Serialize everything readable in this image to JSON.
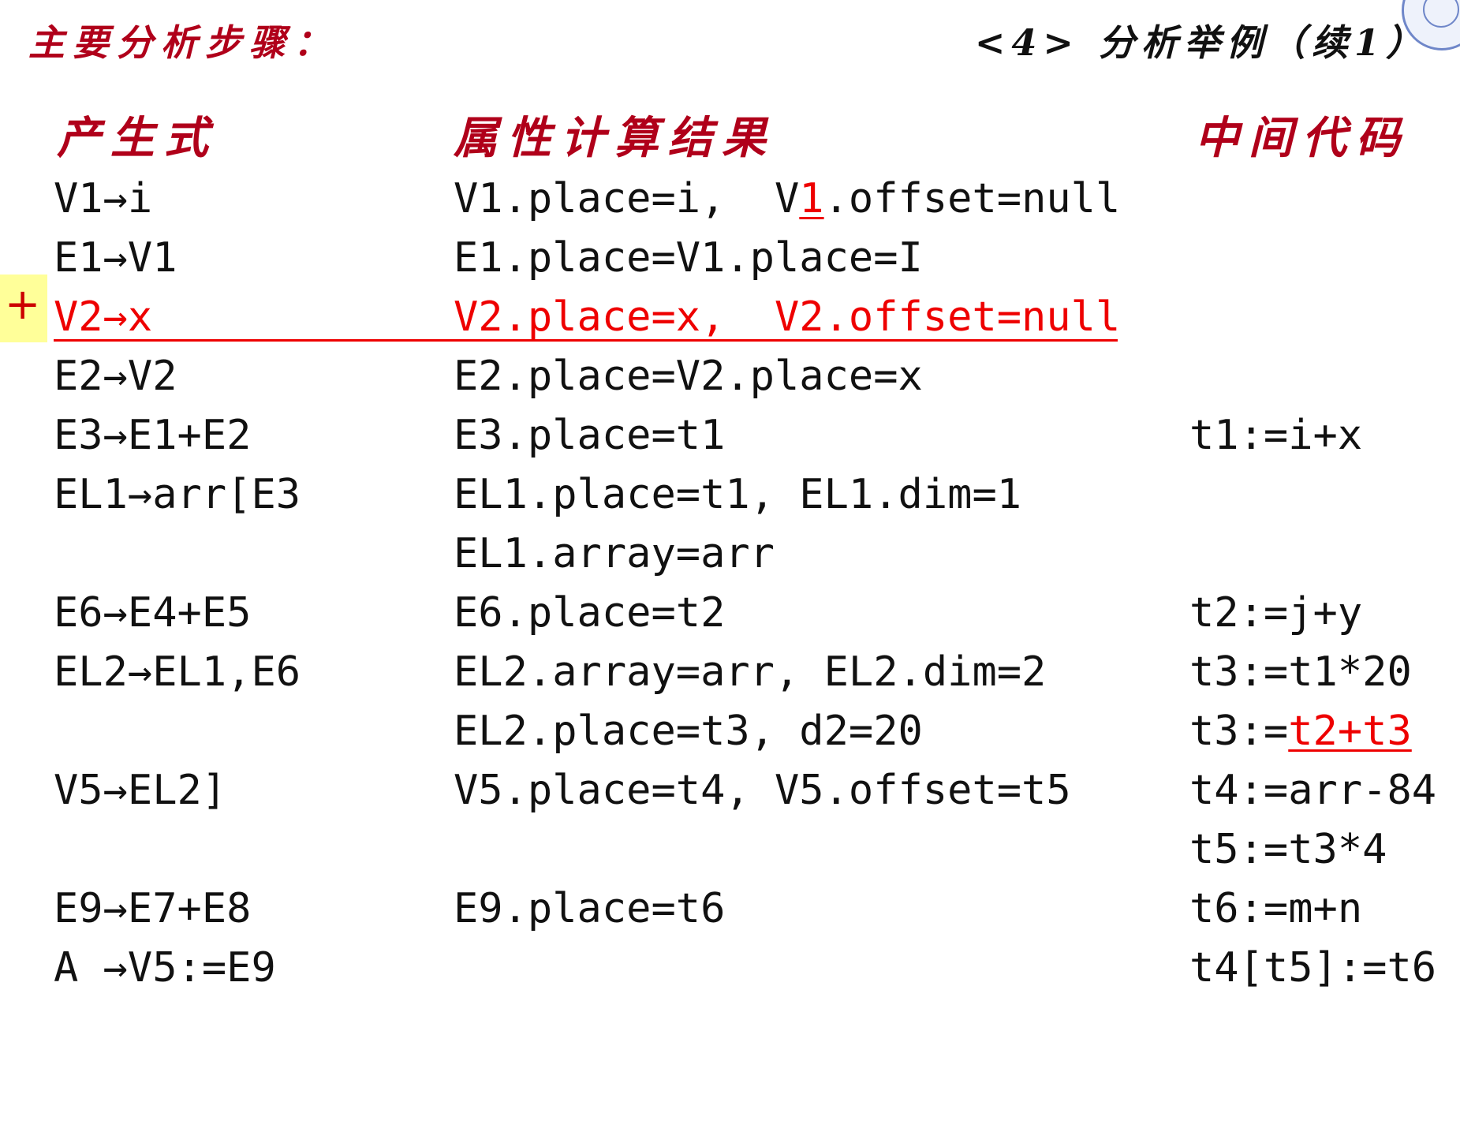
{
  "title": {
    "left": "主要分析步骤：",
    "right": "<4> 分析举例（续1）"
  },
  "headers": {
    "production": "产生式",
    "attribute": "属性计算结果",
    "code": "中间代码"
  },
  "marker": "+",
  "rows": [
    {
      "prod": "V1→i",
      "attr_pre": "V1.place=i,  V",
      "attr_red": "1",
      "attr_post": ".offset=null",
      "code": ""
    },
    {
      "prod": "E1→V1",
      "attr": "E1.place=V1.place=I",
      "code": ""
    },
    {
      "prod": "V2→x",
      "attr": "V2.place=x,  V2.offset=null",
      "code": ""
    },
    {
      "prod": "E2→V2",
      "attr": "E2.place=V2.place=x",
      "code": ""
    },
    {
      "prod": "E3→E1+E2",
      "attr": "E3.place=t1",
      "code": "t1:=i+x"
    },
    {
      "prod": "EL1→arr[E3",
      "attr": "EL1.place=t1, EL1.dim=1",
      "code": ""
    },
    {
      "prod": "",
      "attr": "EL1.array=arr",
      "code": ""
    },
    {
      "prod": "E6→E4+E5",
      "attr": "E6.place=t2",
      "code": "t2:=j+y"
    },
    {
      "prod": "EL2→EL1,E6",
      "attr": "EL2.array=arr, EL2.dim=2",
      "code": "t3:=t1*20"
    },
    {
      "prod": "",
      "attr": "EL2.place=t3, d2=20",
      "code_pre": "t3:=",
      "code_red": "t2+t3"
    },
    {
      "prod": "V5→EL2]",
      "attr": "V5.place=t4, V5.offset=t5",
      "code": "t4:=arr-84"
    },
    {
      "prod": "",
      "attr": "",
      "code": "t5:=t3*4"
    },
    {
      "prod": "E9→E7+E8",
      "attr": "E9.place=t6",
      "code": "t6:=m+n"
    },
    {
      "prod": "A →V5:=E9",
      "attr": "",
      "code": "t4[t5]:=t6"
    }
  ]
}
